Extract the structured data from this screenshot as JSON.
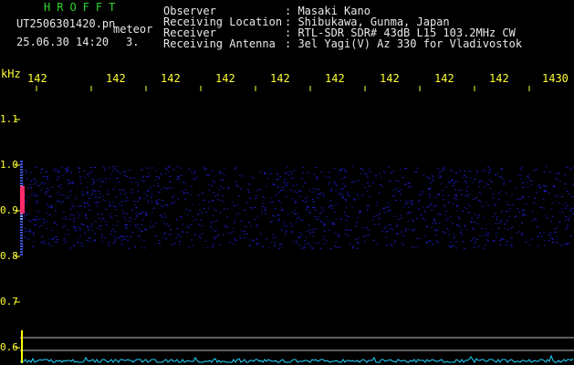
{
  "header": {
    "brand": "HROFFT",
    "filename": "UT2506301420.pn",
    "mode": "meteor",
    "timestamp": "25.06.30 14:20",
    "extra": "3.",
    "fields": [
      {
        "label": "Observer",
        "value": ": Masaki Kano"
      },
      {
        "label": "Receiving Location",
        "value": ": Shibukawa, Gunma, Japan"
      },
      {
        "label": "Receiver",
        "value": ": RTL-SDR SDR# 43dB L15 103.2MHz CW"
      },
      {
        "label": "Receiving Antenna",
        "value": ": 3el Yagi(V) Az 330 for Vladivostok"
      }
    ]
  },
  "plot": {
    "unit_label": "kHz",
    "x_ticks": [
      "142",
      "142",
      "142",
      "142",
      "142",
      "142",
      "142",
      "142",
      "142",
      "1430"
    ],
    "y_ticks": [
      "1.1",
      "1.0",
      "0.9",
      "0.8",
      "0.7",
      "0.6"
    ],
    "colors": {
      "background": "#000000",
      "noise": "#1a1aa0",
      "signal": "#ff2a6a",
      "tick_text": "#ffff33",
      "spectrum": "#22d4ff"
    }
  }
}
